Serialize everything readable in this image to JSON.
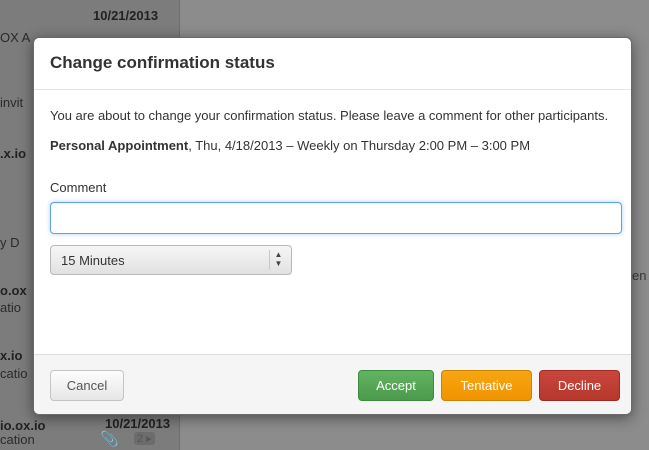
{
  "background": {
    "list_items": [
      {
        "text": "10/21/2013",
        "strong": true
      },
      {
        "text": "OX A",
        "strong": false
      },
      {
        "text": "invit",
        "strong": false
      },
      {
        "text": ".x.io",
        "strong": true
      },
      {
        "text": "y D",
        "strong": false
      },
      {
        "text": "o.ox",
        "strong": true
      },
      {
        "text": "atio",
        "strong": false
      },
      {
        "text": "x.io",
        "strong": true
      },
      {
        "text": "catio",
        "strong": false
      },
      {
        "text": "io.ox.io",
        "strong": true
      },
      {
        "text": "10/21/2013",
        "strong": true
      },
      {
        "text": "cation",
        "strong": false
      },
      {
        "text": "2 ▸",
        "strong": false
      }
    ],
    "right_text": "en"
  },
  "dialog": {
    "title": "Change confirmation status",
    "message": "You are about to change your confirmation status. Please leave a comment for other participants.",
    "appointment_title": "Personal Appointment",
    "appointment_details": ", Thu, 4/18/2013 – Weekly on Thursday 2:00 PM – 3:00 PM",
    "comment_label": "Comment",
    "comment_value": "",
    "reminder_selected": "15 Minutes",
    "buttons": {
      "cancel": "Cancel",
      "accept": "Accept",
      "tentative": "Tentative",
      "decline": "Decline"
    }
  },
  "colors": {
    "accept": "#5cb85c",
    "tentative": "#f0a00c",
    "decline": "#bd3f35",
    "focus": "#66a3e0"
  },
  "icons": {
    "attachment": "paperclip-icon",
    "select_arrow": "up-down-arrows-icon"
  }
}
